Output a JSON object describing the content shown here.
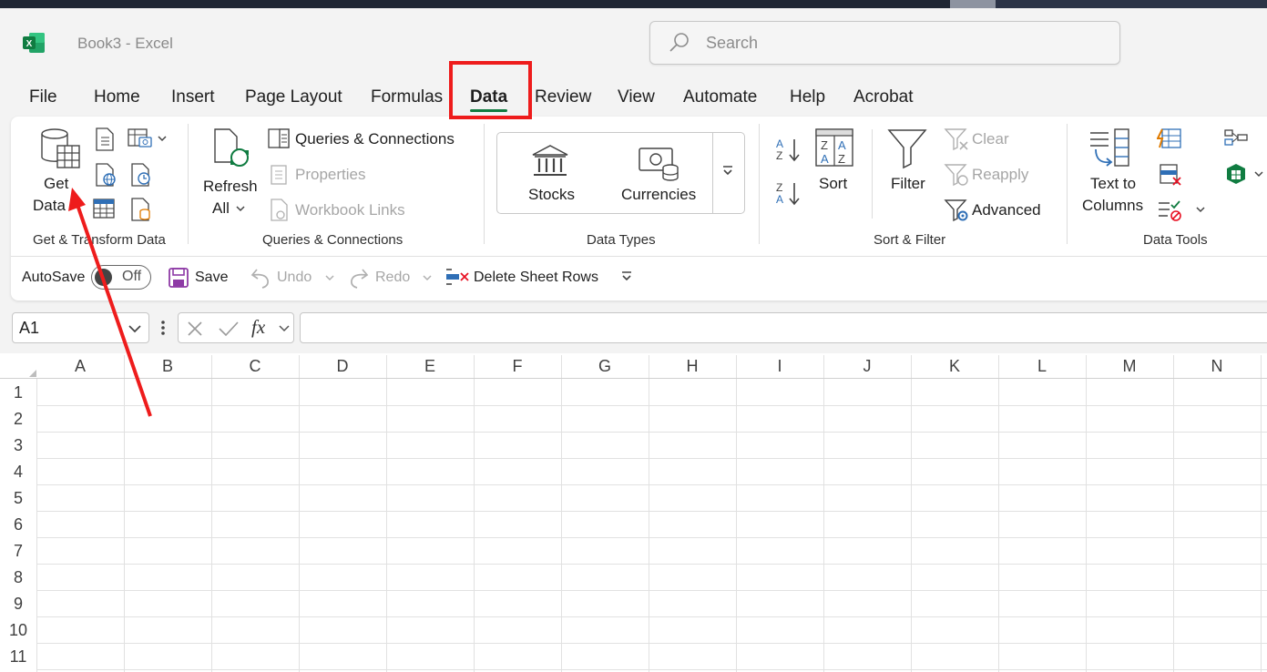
{
  "window": {
    "title": "Book3  -  Excel"
  },
  "search": {
    "placeholder": "Search"
  },
  "tabs": [
    "File",
    "Home",
    "Insert",
    "Page Layout",
    "Formulas",
    "Data",
    "Review",
    "View",
    "Automate",
    "Help",
    "Acrobat"
  ],
  "active_tab": "Data",
  "ribbon": {
    "get_data": {
      "line1": "Get",
      "line2": "Data"
    },
    "refresh": {
      "line1": "Refresh",
      "line2": "All"
    },
    "queries_connections": "Queries & Connections",
    "properties": "Properties",
    "workbook_links": "Workbook Links",
    "stocks": "Stocks",
    "currencies": "Currencies",
    "sort": "Sort",
    "filter": "Filter",
    "clear": "Clear",
    "reapply": "Reapply",
    "advanced": "Advanced",
    "text_to_columns": {
      "line1": "Text to",
      "line2": "Columns"
    },
    "groups": {
      "get_transform": "Get & Transform Data",
      "queries": "Queries & Connections",
      "data_types": "Data Types",
      "sort_filter": "Sort & Filter",
      "data_tools": "Data Tools"
    }
  },
  "quick_access": {
    "autosave": "AutoSave",
    "toggle_state": "Off",
    "save": "Save",
    "undo": "Undo",
    "redo": "Redo",
    "delete_rows": "Delete Sheet Rows"
  },
  "formula_bar": {
    "name_box": "A1",
    "fx": "fx",
    "value": ""
  },
  "sheet": {
    "columns": [
      "A",
      "B",
      "C",
      "D",
      "E",
      "F",
      "G",
      "H",
      "I",
      "J",
      "K",
      "L",
      "M",
      "N"
    ],
    "rows": [
      "1",
      "2",
      "3",
      "4",
      "5",
      "6",
      "7",
      "8",
      "9",
      "10",
      "11"
    ]
  },
  "annotation": {
    "color": "#ee1c1c"
  },
  "colors": {
    "excel_green": "#107c41",
    "accent_blue": "#2f6fb6"
  }
}
